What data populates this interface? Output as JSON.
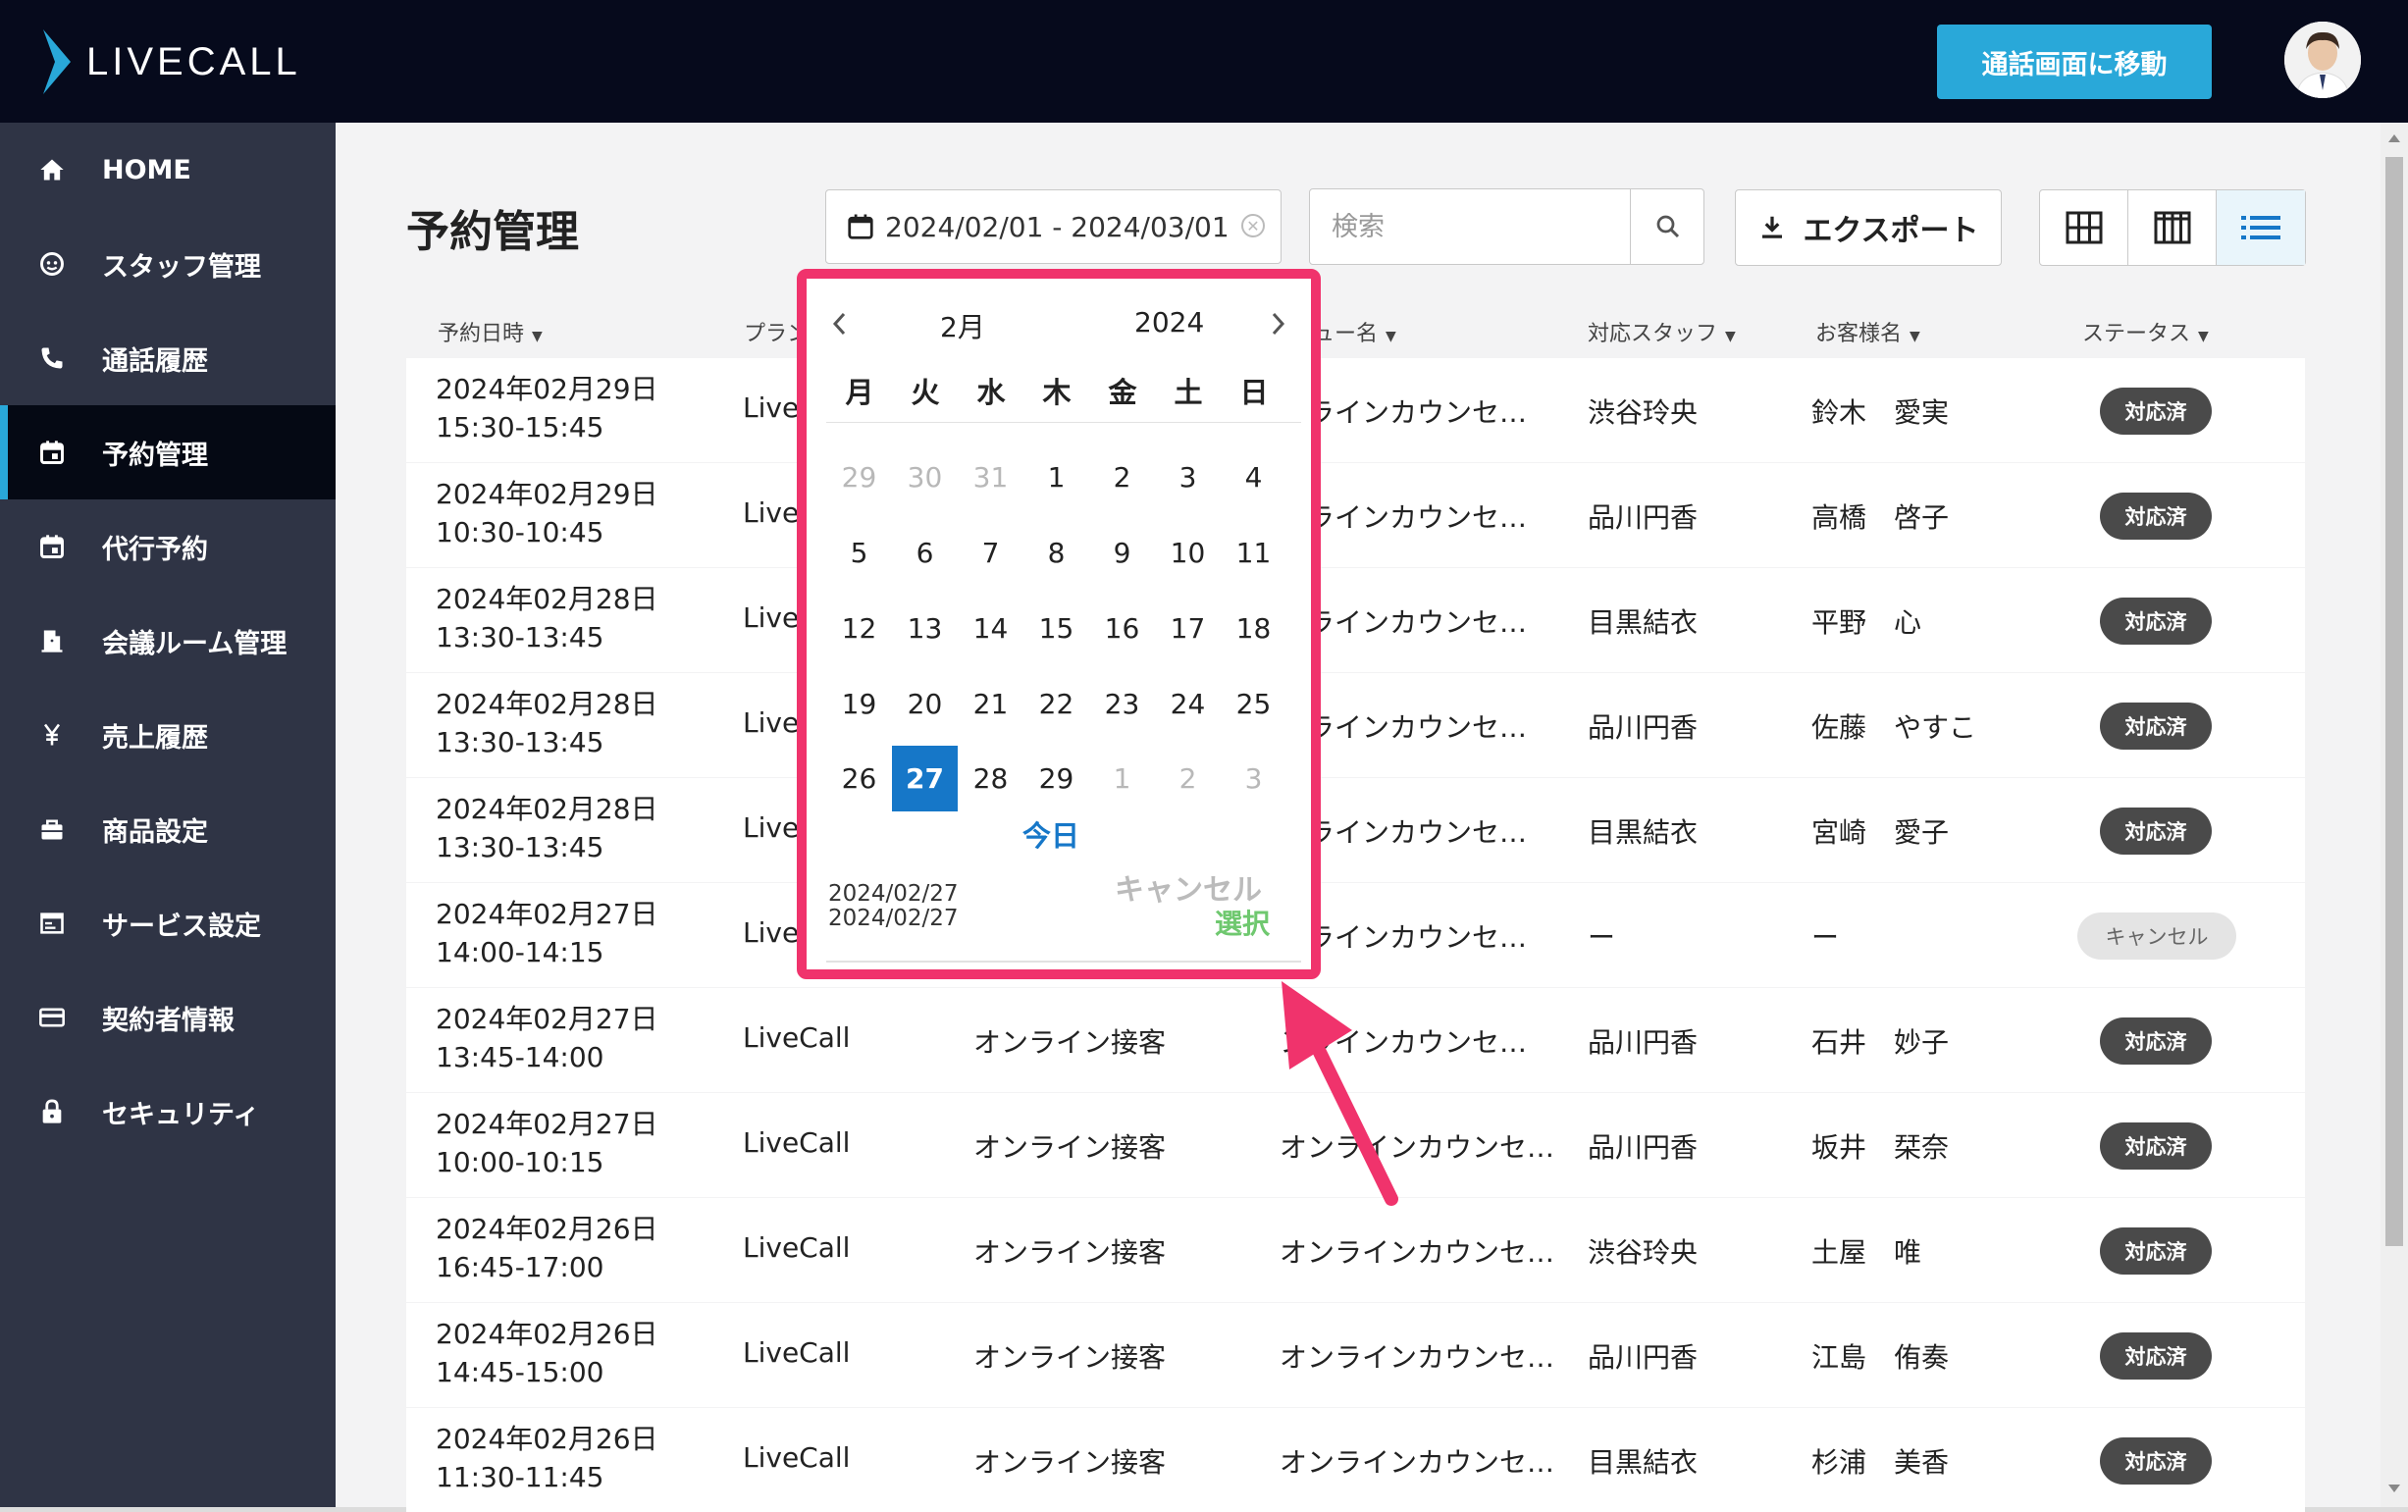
{
  "header": {
    "logo_text": "LIVECALL",
    "call_button_label": "通話画面に移動"
  },
  "sidebar": {
    "items": [
      {
        "label": "HOME",
        "icon": "home-icon"
      },
      {
        "label": "スタッフ管理",
        "icon": "staff-icon"
      },
      {
        "label": "通話履歴",
        "icon": "phone-icon"
      },
      {
        "label": "予約管理",
        "icon": "calendar-icon",
        "active": true
      },
      {
        "label": "代行予約",
        "icon": "calendar-icon"
      },
      {
        "label": "会議ルーム管理",
        "icon": "door-icon"
      },
      {
        "label": "売上履歴",
        "icon": "yen-icon"
      },
      {
        "label": "商品設定",
        "icon": "bag-icon"
      },
      {
        "label": "サービス設定",
        "icon": "service-icon"
      },
      {
        "label": "契約者情報",
        "icon": "card-icon"
      },
      {
        "label": "セキュリティ",
        "icon": "lock-icon"
      }
    ]
  },
  "page": {
    "title": "予約管理",
    "date_range": "2024/02/01 - 2024/03/01",
    "search_placeholder": "検索",
    "export_label": "エクスポート"
  },
  "table": {
    "headers": [
      "予約日時",
      "プラン",
      "ュー名",
      "対応スタッフ",
      "お客様名",
      "ステータス"
    ],
    "rows": [
      {
        "date": "2024年02月29日",
        "time": "15:30-15:45",
        "plan": "Live",
        "menu": "",
        "detail": "ンラインカウンセ…",
        "staff": "渋谷玲央",
        "customer": "鈴木　愛実",
        "status": "対応済"
      },
      {
        "date": "2024年02月29日",
        "time": "10:30-10:45",
        "plan": "Live",
        "menu": "",
        "detail": "ンラインカウンセ…",
        "staff": "品川円香",
        "customer": "高橋　啓子",
        "status": "対応済"
      },
      {
        "date": "2024年02月28日",
        "time": "13:30-13:45",
        "plan": "Live",
        "menu": "",
        "detail": "ンラインカウンセ…",
        "staff": "目黒結衣",
        "customer": "平野　心",
        "status": "対応済"
      },
      {
        "date": "2024年02月28日",
        "time": "13:30-13:45",
        "plan": "Live",
        "menu": "",
        "detail": "ンラインカウンセ…",
        "staff": "品川円香",
        "customer": "佐藤　やすこ",
        "status": "対応済"
      },
      {
        "date": "2024年02月28日",
        "time": "13:30-13:45",
        "plan": "Live",
        "menu": "",
        "detail": "ンラインカウンセ…",
        "staff": "目黒結衣",
        "customer": "宮崎　愛子",
        "status": "対応済"
      },
      {
        "date": "2024年02月27日",
        "time": "14:00-14:15",
        "plan": "Live",
        "menu": "",
        "detail": "ンラインカウンセ…",
        "staff": "ー",
        "customer": "ー",
        "status": "キャンセル"
      },
      {
        "date": "2024年02月27日",
        "time": "13:45-14:00",
        "plan": "LiveCall",
        "menu": "オンライン接客",
        "detail": "ンラインカウンセ…",
        "staff": "品川円香",
        "customer": "石井　妙子",
        "status": "対応済"
      },
      {
        "date": "2024年02月27日",
        "time": "10:00-10:15",
        "plan": "LiveCall",
        "menu": "オンライン接客",
        "detail": "オンラインカウンセ…",
        "staff": "品川円香",
        "customer": "坂井　栞奈",
        "status": "対応済"
      },
      {
        "date": "2024年02月26日",
        "time": "16:45-17:00",
        "plan": "LiveCall",
        "menu": "オンライン接客",
        "detail": "オンラインカウンセ…",
        "staff": "渋谷玲央",
        "customer": "土屋　唯",
        "status": "対応済"
      },
      {
        "date": "2024年02月26日",
        "time": "14:45-15:00",
        "plan": "LiveCall",
        "menu": "オンライン接客",
        "detail": "オンラインカウンセ…",
        "staff": "品川円香",
        "customer": "江島　侑奏",
        "status": "対応済"
      },
      {
        "date": "2024年02月26日",
        "time": "11:30-11:45",
        "plan": "LiveCall",
        "menu": "オンライン接客",
        "detail": "オンラインカウンセ…",
        "staff": "目黒結衣",
        "customer": "杉浦　美香",
        "status": "対応済"
      }
    ]
  },
  "datepicker": {
    "month": "2月",
    "year": "2024",
    "weekdays": [
      "月",
      "火",
      "水",
      "木",
      "金",
      "土",
      "日"
    ],
    "weeks": [
      [
        {
          "d": "29",
          "m": true
        },
        {
          "d": "30",
          "m": true
        },
        {
          "d": "31",
          "m": true
        },
        {
          "d": "1"
        },
        {
          "d": "2"
        },
        {
          "d": "3"
        },
        {
          "d": "4"
        }
      ],
      [
        {
          "d": "5"
        },
        {
          "d": "6"
        },
        {
          "d": "7"
        },
        {
          "d": "8"
        },
        {
          "d": "9"
        },
        {
          "d": "10"
        },
        {
          "d": "11"
        }
      ],
      [
        {
          "d": "12"
        },
        {
          "d": "13"
        },
        {
          "d": "14"
        },
        {
          "d": "15"
        },
        {
          "d": "16"
        },
        {
          "d": "17"
        },
        {
          "d": "18"
        }
      ],
      [
        {
          "d": "19"
        },
        {
          "d": "20"
        },
        {
          "d": "21"
        },
        {
          "d": "22"
        },
        {
          "d": "23"
        },
        {
          "d": "24"
        },
        {
          "d": "25"
        }
      ],
      [
        {
          "d": "26"
        },
        {
          "d": "27",
          "sel": true
        },
        {
          "d": "28"
        },
        {
          "d": "29"
        },
        {
          "d": "1",
          "m": true
        },
        {
          "d": "2",
          "m": true
        },
        {
          "d": "3",
          "m": true
        }
      ]
    ],
    "today_label": "今日",
    "selected_start": "2024/02/27",
    "selected_end": "2024/02/27",
    "cancel_label": "キャンセル",
    "ok_label": "選択"
  },
  "colors": {
    "accent": "#29a8d9",
    "highlight": "#f0336c",
    "selected_day": "#1677c8",
    "ok": "#6fc86f"
  }
}
